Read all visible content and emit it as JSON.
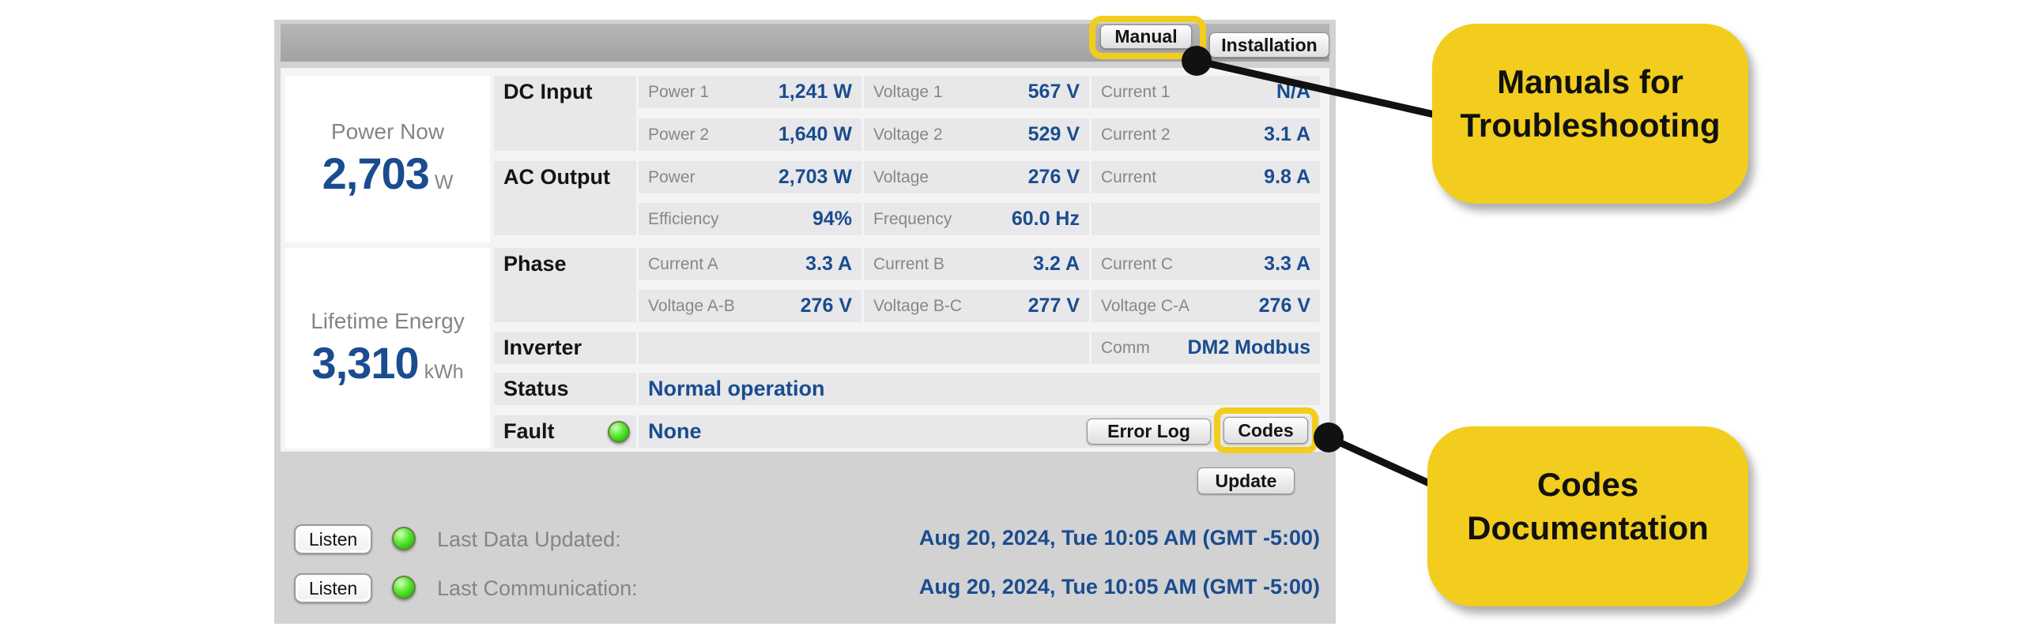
{
  "header": {
    "manual_label": "Manual",
    "installation_label": "Installation"
  },
  "summary": {
    "power_now": {
      "title": "Power Now",
      "value": "2,703",
      "unit": "W"
    },
    "lifetime_energy": {
      "title": "Lifetime Energy",
      "value": "3,310",
      "unit": "kWh"
    }
  },
  "table": {
    "dc_input": {
      "section": "DC Input",
      "power1": {
        "label": "Power 1",
        "value": "1,241 W"
      },
      "voltage1": {
        "label": "Voltage 1",
        "value": "567 V"
      },
      "current1": {
        "label": "Current 1",
        "value": "N/A"
      },
      "power2": {
        "label": "Power 2",
        "value": "1,640 W"
      },
      "voltage2": {
        "label": "Voltage 2",
        "value": "529 V"
      },
      "current2": {
        "label": "Current 2",
        "value": "3.1 A"
      }
    },
    "ac_output": {
      "section": "AC Output",
      "power": {
        "label": "Power",
        "value": "2,703 W"
      },
      "voltage": {
        "label": "Voltage",
        "value": "276 V"
      },
      "current": {
        "label": "Current",
        "value": "9.8 A"
      },
      "efficiency": {
        "label": "Efficiency",
        "value": "94%"
      },
      "frequency": {
        "label": "Frequency",
        "value": "60.0 Hz"
      }
    },
    "phase": {
      "section": "Phase",
      "current_a": {
        "label": "Current A",
        "value": "3.3 A"
      },
      "current_b": {
        "label": "Current B",
        "value": "3.2 A"
      },
      "current_c": {
        "label": "Current C",
        "value": "3.3 A"
      },
      "voltage_ab": {
        "label": "Voltage A-B",
        "value": "276 V"
      },
      "voltage_bc": {
        "label": "Voltage B-C",
        "value": "277 V"
      },
      "voltage_ca": {
        "label": "Voltage C-A",
        "value": "276 V"
      }
    },
    "inverter": {
      "section": "Inverter",
      "comm": {
        "label": "Comm",
        "value": "DM2 Modbus"
      }
    },
    "status": {
      "section": "Status",
      "value": "Normal operation"
    },
    "fault": {
      "section": "Fault",
      "value": "None"
    }
  },
  "actions": {
    "error_log_label": "Error Log",
    "codes_label": "Codes",
    "update_label": "Update",
    "listen_label": "Listen"
  },
  "footer": {
    "last_data_updated": {
      "label": "Last Data Updated:",
      "value": "Aug 20, 2024, Tue 10:05 AM (GMT -5:00)"
    },
    "last_communication": {
      "label": "Last Communication:",
      "value": "Aug 20, 2024, Tue 10:05 AM (GMT -5:00)"
    }
  },
  "annotations": {
    "manual_callout": "Manuals for\nTroubleshooting",
    "codes_callout": "Codes\nDocumentation"
  },
  "colors": {
    "accent_blue": "#1a4c8f",
    "highlight_yellow": "#f2cd1d",
    "led_green": "#2fc912",
    "panel_gray": "#d2d2d3"
  }
}
